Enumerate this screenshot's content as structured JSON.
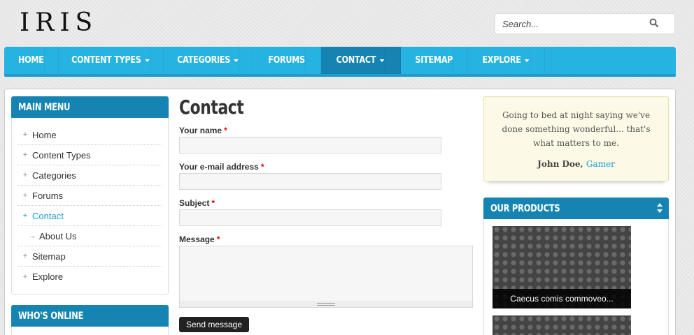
{
  "header": {
    "logo": "IRIS",
    "search_placeholder": "Search..."
  },
  "nav": {
    "items": [
      {
        "label": "HOME",
        "dropdown": false
      },
      {
        "label": "CONTENT TYPES",
        "dropdown": true
      },
      {
        "label": "CATEGORIES",
        "dropdown": true
      },
      {
        "label": "FORUMS",
        "dropdown": false
      },
      {
        "label": "CONTACT",
        "dropdown": true,
        "active": true
      },
      {
        "label": "SITEMAP",
        "dropdown": false
      },
      {
        "label": "EXPLORE",
        "dropdown": true
      }
    ]
  },
  "sidebar": {
    "main_menu_title": "MAIN MENU",
    "items": [
      {
        "label": "Home"
      },
      {
        "label": "Content Types"
      },
      {
        "label": "Categories"
      },
      {
        "label": "Forums"
      },
      {
        "label": "Contact",
        "active": true
      },
      {
        "label": "About Us",
        "sub": true
      },
      {
        "label": "Sitemap"
      },
      {
        "label": "Explore"
      }
    ],
    "whos_online_title": "WHO'S ONLINE"
  },
  "form": {
    "heading": "Contact",
    "name_label": "Your name",
    "email_label": "Your e-mail address",
    "subject_label": "Subject",
    "message_label": "Message",
    "required_mark": "*",
    "send_label": "Send message"
  },
  "quote": {
    "text": "Going to bed at night saying we've done something wonderful... that's what matters to me.",
    "author": "John Doe,",
    "role": "Gamer"
  },
  "products": {
    "title": "OUR PRODUCTS",
    "items": [
      {
        "caption": "Caecus comis commoveo..."
      },
      {
        "caption": ""
      }
    ]
  },
  "colors": {
    "nav_bg": "#26b3e2",
    "nav_active": "#1584b3",
    "block_title": "#1584b3",
    "link": "#1e9bcf",
    "required": "#dd0000"
  }
}
